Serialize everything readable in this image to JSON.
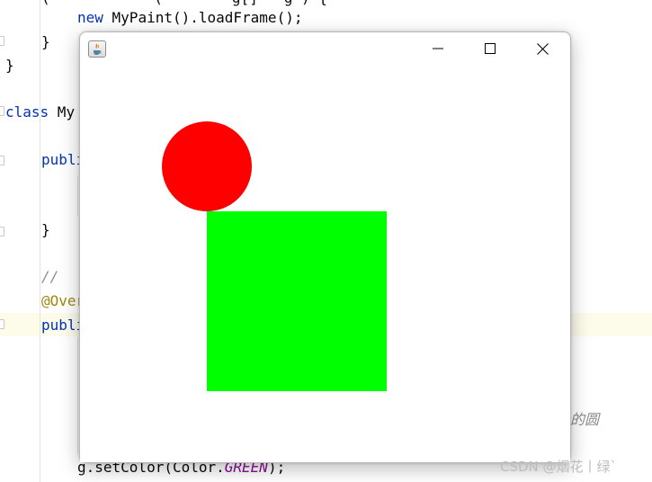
{
  "editor": {
    "lines": {
      "l1_kw": "new",
      "l1_rest": " MyPaint().loadFrame();",
      "l2": "}",
      "l3": "}",
      "l4_kw": "class",
      "l4_rest": " My",
      "l5": "publi",
      "l6": "}",
      "l7": "//",
      "l8": "@Over",
      "l9": "publi",
      "l10_a": "g.setColor(Color.",
      "l10_b": "GREEN",
      "l10_c": ");"
    },
    "right_fragment": "的圆",
    "colors": {
      "keyword": "#0033b3",
      "annotation": "#9e880d",
      "comment": "#8c8c8c",
      "constant": "#871094",
      "current_line": "#fdfbe9"
    }
  },
  "window": {
    "title_icon": "java-cup-icon",
    "controls": {
      "minimize": "minimize-icon",
      "maximize": "maximize-icon",
      "close": "close-icon"
    },
    "canvas": {
      "background": "#ffffff",
      "shapes": [
        {
          "type": "circle",
          "color": "#ff0000"
        },
        {
          "type": "rectangle",
          "color": "#00ff00"
        }
      ]
    }
  },
  "watermark": "CSDN @烟花丨绿`"
}
